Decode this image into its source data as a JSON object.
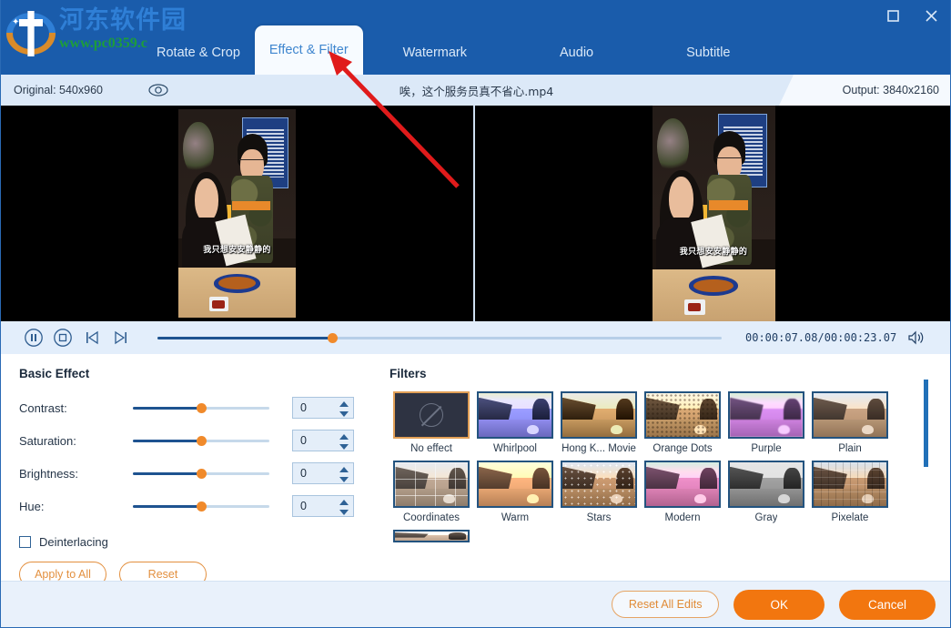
{
  "window": {
    "logo_cn": "河东软件园",
    "logo_url": "www.pc0359.c",
    "maximize_label": "Maximize",
    "close_label": "Close"
  },
  "tabs": [
    {
      "label": "Rotate & Crop",
      "active": false
    },
    {
      "label": "Effect & Filter",
      "active": true
    },
    {
      "label": "Watermark",
      "active": false
    },
    {
      "label": "Audio",
      "active": false
    },
    {
      "label": "Subtitle",
      "active": false
    }
  ],
  "infobar": {
    "original": "Original: 540x960",
    "filename": "唉，这个服务员真不省心.mp4",
    "output": "Output: 3840x2160"
  },
  "preview": {
    "subtitle": "我只想安安静静的"
  },
  "transport": {
    "pause_label": "Pause",
    "stop_label": "Stop",
    "prev_label": "Previous frame",
    "next_label": "Next frame",
    "time": "00:00:07.08/00:00:23.07",
    "progress_percent": 31,
    "volume_label": "Volume"
  },
  "basic_effect": {
    "title": "Basic Effect",
    "sliders": [
      {
        "label": "Contrast:",
        "value": "0",
        "percent": 50
      },
      {
        "label": "Saturation:",
        "value": "0",
        "percent": 50
      },
      {
        "label": "Brightness:",
        "value": "0",
        "percent": 50
      },
      {
        "label": "Hue:",
        "value": "0",
        "percent": 50
      }
    ],
    "deinterlacing_label": "Deinterlacing",
    "deinterlacing_checked": false,
    "apply_all_label": "Apply to All",
    "reset_label": "Reset"
  },
  "filters": {
    "title": "Filters",
    "items": [
      {
        "label": "No effect",
        "selected": true,
        "style": "none"
      },
      {
        "label": "Whirlpool",
        "selected": false,
        "style": "whirlpool"
      },
      {
        "label": "Hong K... Movie",
        "selected": false,
        "style": "hongkong"
      },
      {
        "label": "Orange Dots",
        "selected": false,
        "style": "orangedots"
      },
      {
        "label": "Purple",
        "selected": false,
        "style": "purple"
      },
      {
        "label": "Plain",
        "selected": false,
        "style": "plain"
      },
      {
        "label": "Coordinates",
        "selected": false,
        "style": "coordinates"
      },
      {
        "label": "Warm",
        "selected": false,
        "style": "warm"
      },
      {
        "label": "Stars",
        "selected": false,
        "style": "stars"
      },
      {
        "label": "Modern",
        "selected": false,
        "style": "modern"
      },
      {
        "label": "Gray",
        "selected": false,
        "style": "gray"
      },
      {
        "label": "Pixelate",
        "selected": false,
        "style": "pixelate"
      }
    ],
    "scroll_percent": 0
  },
  "footer": {
    "reset_all_label": "Reset All Edits",
    "ok_label": "OK",
    "cancel_label": "Cancel"
  },
  "colors": {
    "header_blue": "#1a5cab",
    "accent_orange": "#f2760f",
    "slider_thumb": "#f08a2b",
    "tab_active_text": "#3f86cf"
  }
}
